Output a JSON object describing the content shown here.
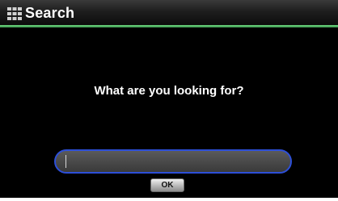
{
  "titlebar": {
    "title": "Search",
    "icon": "keyboard-grid-icon"
  },
  "dialog": {
    "prompt": "What are you looking for?",
    "search": {
      "value": "",
      "placeholder": ""
    },
    "ok_label": "OK"
  },
  "colors": {
    "background": "#000000",
    "accent_line": "#5cc26c",
    "input_border": "#2d4fd8",
    "input_fill": "#4a4a4a"
  }
}
